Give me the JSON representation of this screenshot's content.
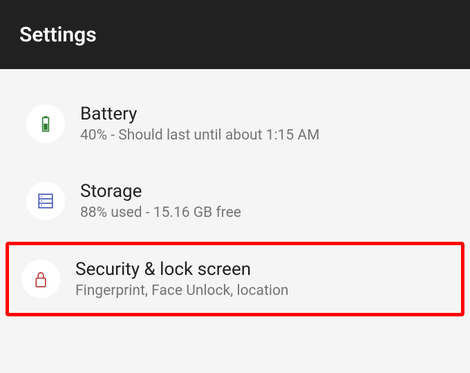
{
  "header": {
    "title": "Settings"
  },
  "items": [
    {
      "icon": "battery",
      "title": "Battery",
      "subtitle": "40% - Should last until about 1:15 AM"
    },
    {
      "icon": "storage",
      "title": "Storage",
      "subtitle": "88% used - 15.16 GB free"
    },
    {
      "icon": "lock",
      "title": "Security & lock screen",
      "subtitle": "Fingerprint, Face Unlock, location"
    }
  ],
  "colors": {
    "battery_icon": "#2e7d32",
    "storage_icon": "#3f51b5",
    "lock_icon": "#b71c1c"
  }
}
